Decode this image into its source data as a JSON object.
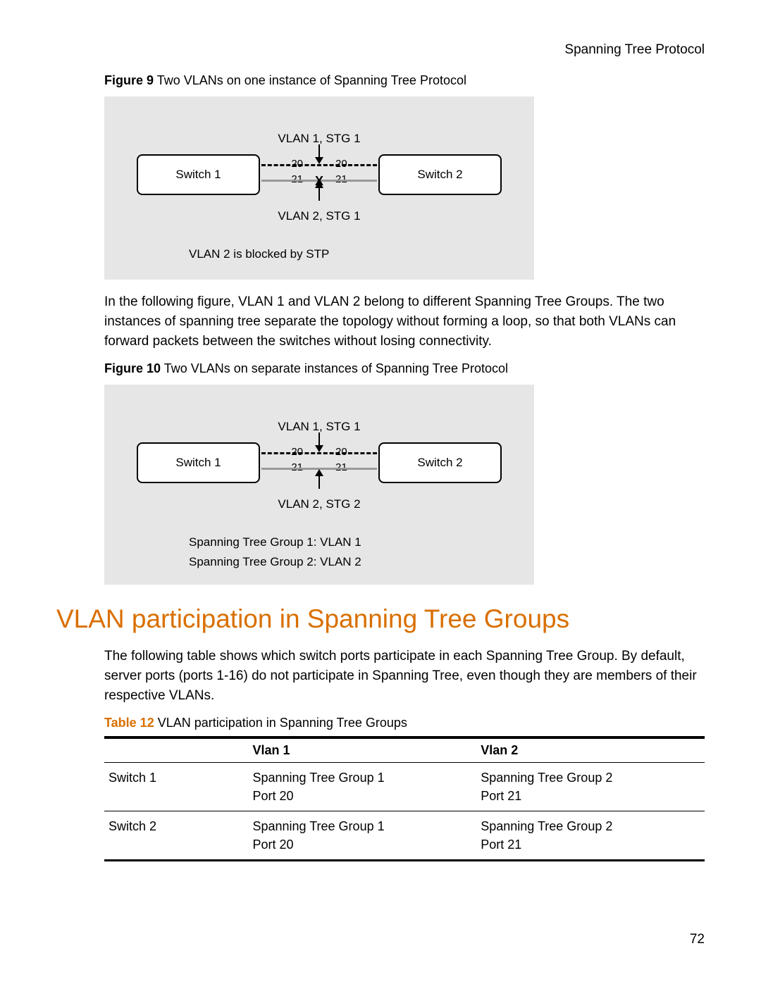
{
  "header": {
    "title": "Spanning Tree Protocol"
  },
  "figure9": {
    "label": "Figure 9",
    "caption": "Two VLANs on one instance of Spanning Tree Protocol",
    "top_label": "VLAN 1, STG 1",
    "bottom_label": "VLAN 2, STG 1",
    "switch1": "Switch 1",
    "switch2": "Switch 2",
    "port_a": "20",
    "port_b": "21",
    "x_mark": "X",
    "footnote": "VLAN 2 is blocked by STP"
  },
  "para1": "In the following figure, VLAN 1 and VLAN 2 belong to different Spanning Tree Groups. The two instances of spanning tree separate the topology without forming a loop, so that both VLANs can forward packets between the switches without losing connectivity.",
  "figure10": {
    "label": "Figure 10",
    "caption": "Two VLANs on separate instances of Spanning Tree Protocol",
    "top_label": "VLAN 1, STG 1",
    "bottom_label": "VLAN 2, STG 2",
    "switch1": "Switch 1",
    "switch2": "Switch 2",
    "port_a": "20",
    "port_b": "21",
    "footnote1": "Spanning Tree Group 1:  VLAN 1",
    "footnote2": "Spanning Tree Group 2:  VLAN 2"
  },
  "heading": "VLAN participation in Spanning Tree Groups",
  "para2": "The following table shows which switch ports participate in each Spanning Tree Group. By default, server ports (ports 1-16) do not participate in Spanning Tree, even though they are members of their respective VLANs.",
  "table": {
    "label": "Table 12",
    "caption": "VLAN participation in Spanning Tree Groups",
    "col_empty": "",
    "col_vlan1": "Vlan 1",
    "col_vlan2": "Vlan 2",
    "rows": [
      {
        "name": "Switch 1",
        "v1_line1": "Spanning Tree Group 1",
        "v1_line2": "Port 20",
        "v2_line1": "Spanning Tree Group 2",
        "v2_line2": "Port 21"
      },
      {
        "name": "Switch 2",
        "v1_line1": "Spanning Tree Group 1",
        "v1_line2": "Port 20",
        "v2_line1": "Spanning Tree Group 2",
        "v2_line2": "Port 21"
      }
    ]
  },
  "page_number": "72"
}
